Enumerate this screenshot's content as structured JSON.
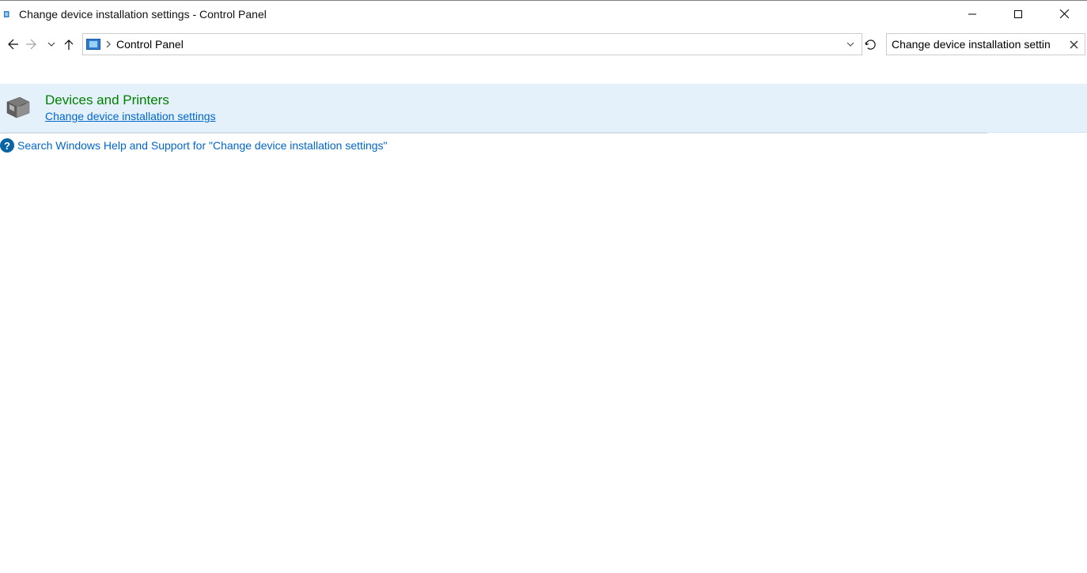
{
  "window": {
    "title": "Change device installation settings - Control Panel"
  },
  "nav": {
    "breadcrumb": "Control Panel",
    "search_value": "Change device installation settin"
  },
  "result": {
    "category": "Devices and Printers",
    "link": "Change device installation settings"
  },
  "help": {
    "text": "Search Windows Help and Support for \"Change device installation settings\""
  }
}
